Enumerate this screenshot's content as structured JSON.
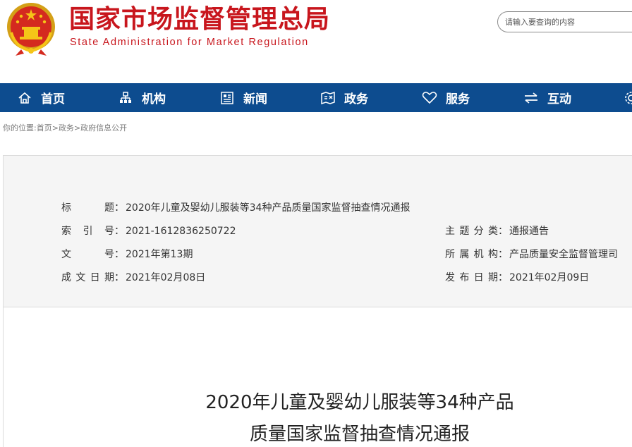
{
  "header": {
    "site_name_cn": "国家市场监督管理总局",
    "site_name_en": "State Administration for Market Regulation",
    "search_placeholder": "请输入要查询的内容",
    "brand_color": "#c8161d"
  },
  "nav": {
    "bg_color": "#0d4c8f",
    "items": [
      {
        "label": "首页",
        "icon": "home-icon"
      },
      {
        "label": "机构",
        "icon": "org-chart-icon"
      },
      {
        "label": "新闻",
        "icon": "news-icon"
      },
      {
        "label": "政务",
        "icon": "government-affairs-icon"
      },
      {
        "label": "服务",
        "icon": "heart-icon"
      },
      {
        "label": "互动",
        "icon": "exchange-arrows-icon"
      }
    ]
  },
  "breadcrumb": {
    "prefix": "你的位置:",
    "items": [
      "首页",
      "政务",
      "政府信息公开"
    ],
    "separator": ">"
  },
  "meta": {
    "title_label": "标题",
    "title_value": "2020年儿童及婴幼儿服装等34种产品质量国家监督抽查情况通报",
    "index_label": "索引号",
    "index_value": "2021-1612836250722",
    "topic_label": "主题分类",
    "topic_value": "通报通告",
    "doc_no_label": "文号",
    "doc_no_value": "2021年第13期",
    "org_label": "所属机构",
    "org_value": "产品质量安全监督管理司",
    "created_label": "成文日期",
    "created_value": "2021年02月08日",
    "published_label": "发布日期",
    "published_value": "2021年02月09日",
    "colon": "："
  },
  "document": {
    "title_line1": "2020年儿童及婴幼儿服装等34种产品",
    "title_line2": "质量国家监督抽查情况通报"
  }
}
